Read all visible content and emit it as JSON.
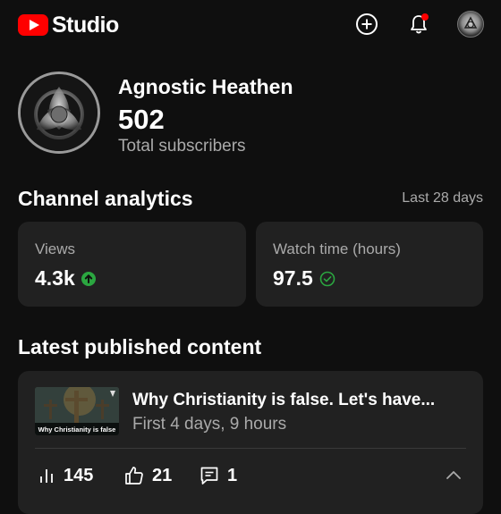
{
  "header": {
    "app_name": "Studio",
    "icons": [
      "create-icon",
      "notifications-icon",
      "account-avatar"
    ],
    "brand_color": "#ff0000",
    "notification_dot_color": "#ff0000"
  },
  "channel": {
    "name": "Agnostic Heathen",
    "subscribers": "502",
    "subscribers_label": "Total subscribers"
  },
  "analytics": {
    "title": "Channel analytics",
    "period": "Last 28 days",
    "views": {
      "label": "Views",
      "value": "4.3k",
      "status_icon": "arrow-up-circle-icon",
      "status_color": "#2ba640"
    },
    "watch_time": {
      "label": "Watch time (hours)",
      "value": "97.5",
      "status_icon": "check-circle-icon",
      "status_color": "#2ba640"
    }
  },
  "latest": {
    "title": "Latest published content",
    "video": {
      "thumbnail_caption": "Why Christianity is false",
      "title": "Why Christianity is false.  Let's have...",
      "subtitle": "First 4 days, 9 hours",
      "views": "145",
      "likes": "21",
      "comments": "1"
    }
  }
}
